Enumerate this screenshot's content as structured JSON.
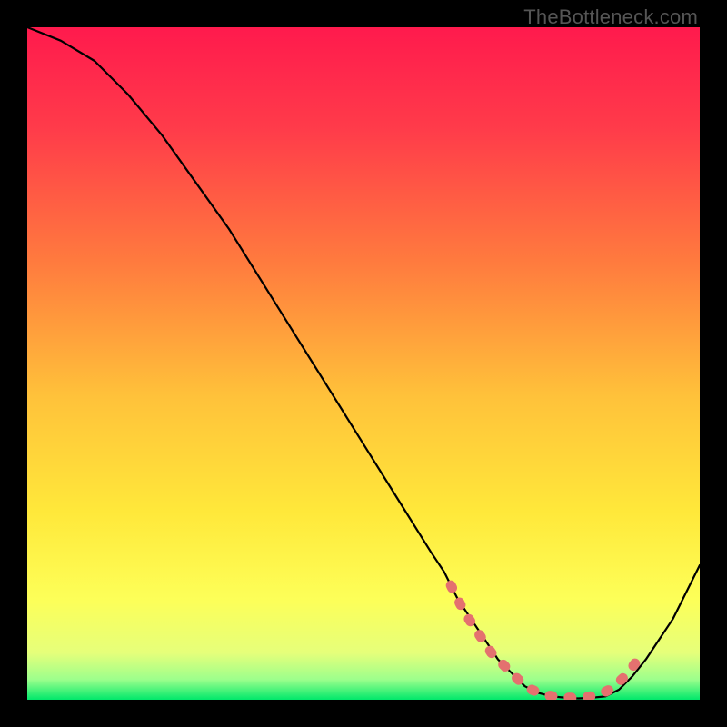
{
  "watermark": "TheBottleneck.com",
  "chart_data": {
    "type": "line",
    "title": "",
    "xlabel": "",
    "ylabel": "",
    "xlim": [
      0,
      100
    ],
    "ylim": [
      0,
      100
    ],
    "series": [
      {
        "name": "bottleneck-curve",
        "x": [
          0,
          5,
          10,
          15,
          20,
          25,
          30,
          35,
          40,
          45,
          50,
          55,
          60,
          62,
          64,
          66,
          68,
          70,
          72,
          74,
          76,
          78,
          80,
          82,
          84,
          86,
          88,
          90,
          92,
          94,
          96,
          98,
          100
        ],
        "y": [
          100,
          98,
          95,
          90,
          84,
          77,
          70,
          62,
          54,
          46,
          38,
          30,
          22,
          19,
          15,
          12,
          9,
          6,
          4,
          2,
          1,
          0.5,
          0.3,
          0.2,
          0.3,
          0.5,
          1.5,
          3.5,
          6,
          9,
          12,
          16,
          20
        ]
      }
    ],
    "highlight_band": {
      "name": "optimal-zone",
      "x": [
        63,
        65,
        67,
        69,
        71,
        73,
        75,
        77,
        79,
        81,
        83,
        85,
        87,
        89,
        91
      ],
      "y": [
        17,
        13,
        10,
        7,
        5,
        3,
        1.5,
        0.7,
        0.4,
        0.3,
        0.4,
        0.7,
        1.7,
        3.6,
        6.2
      ]
    },
    "background_gradient": {
      "stops": [
        {
          "offset": 0.0,
          "color": "#ff1a4d"
        },
        {
          "offset": 0.15,
          "color": "#ff3b4a"
        },
        {
          "offset": 0.35,
          "color": "#ff7b3e"
        },
        {
          "offset": 0.55,
          "color": "#ffc23a"
        },
        {
          "offset": 0.72,
          "color": "#ffe83a"
        },
        {
          "offset": 0.85,
          "color": "#fdff58"
        },
        {
          "offset": 0.93,
          "color": "#e6ff7a"
        },
        {
          "offset": 0.97,
          "color": "#9cff8c"
        },
        {
          "offset": 1.0,
          "color": "#00e86b"
        }
      ]
    }
  }
}
